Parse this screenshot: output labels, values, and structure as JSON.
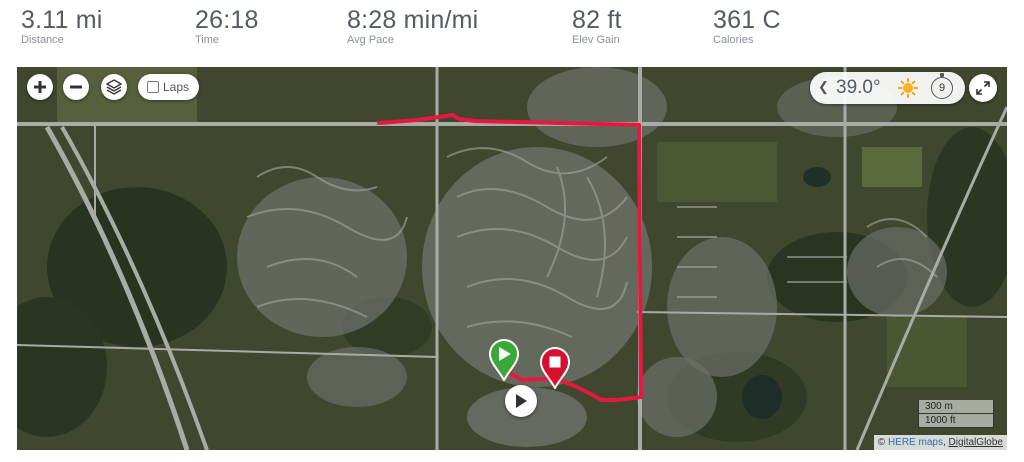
{
  "stats": [
    {
      "value": "3.11 mi",
      "label": "Distance"
    },
    {
      "value": "26:18",
      "label": "Time"
    },
    {
      "value": "8:28 min/mi",
      "label": "Avg Pace"
    },
    {
      "value": "82 ft",
      "label": "Elev Gain"
    },
    {
      "value": "361 C",
      "label": "Calories"
    }
  ],
  "map": {
    "controls": {
      "zoom_in_icon": "plus-icon",
      "zoom_out_icon": "minus-icon",
      "layers_icon": "layers-icon",
      "laps_label": "Laps",
      "laps_checked": false
    },
    "weather": {
      "temperature": "39.0°",
      "condition_icon": "sun-icon",
      "wind_value": "9"
    },
    "scale": {
      "metric": "300 m",
      "imperial": "1000 ft"
    },
    "attribution": {
      "prefix": "©",
      "provider": "HERE maps",
      "separator": ",",
      "imagery": "DigitalGlobe"
    },
    "route_color": "#e8173f",
    "start_marker_color": "#3aa83a",
    "end_marker_color": "#d8102f"
  }
}
